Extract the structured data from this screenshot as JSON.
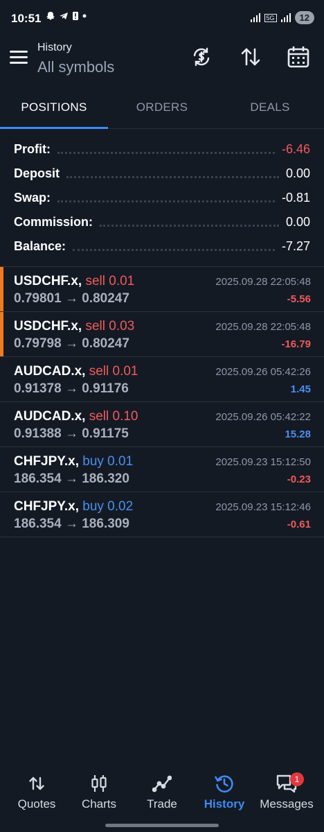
{
  "status_bar": {
    "time": "10:51",
    "battery": "12",
    "network": "5G"
  },
  "header": {
    "title": "History",
    "subtitle": "All symbols",
    "icons": [
      "menu-icon",
      "currency-swap-icon",
      "sort-icon",
      "calendar-icon"
    ]
  },
  "tabs": [
    {
      "label": "POSITIONS",
      "active": true
    },
    {
      "label": "ORDERS",
      "active": false
    },
    {
      "label": "DEALS",
      "active": false
    }
  ],
  "summary": [
    {
      "label": "Profit:",
      "value": "-6.46",
      "negative": true
    },
    {
      "label": "Deposit",
      "value": "0.00",
      "negative": false
    },
    {
      "label": "Swap:",
      "value": "-0.81",
      "negative": false
    },
    {
      "label": "Commission:",
      "value": "0.00",
      "negative": false
    },
    {
      "label": "Balance:",
      "value": "-7.27",
      "negative": false
    }
  ],
  "deals": [
    {
      "symbol": "USDCHF.x,",
      "side": "sell 0.01",
      "side_type": "sell",
      "prices": "0.79801 → 0.80247",
      "time": "2025.09.28 22:05:48",
      "profit": "-5.56",
      "profit_type": "neg",
      "marked": true
    },
    {
      "symbol": "USDCHF.x,",
      "side": "sell 0.03",
      "side_type": "sell",
      "prices": "0.79798 → 0.80247",
      "time": "2025.09.28 22:05:48",
      "profit": "-16.79",
      "profit_type": "neg",
      "marked": true
    },
    {
      "symbol": "AUDCAD.x,",
      "side": "sell 0.01",
      "side_type": "sell",
      "prices": "0.91378 → 0.91176",
      "time": "2025.09.26 05:42:26",
      "profit": "1.45",
      "profit_type": "pos",
      "marked": false
    },
    {
      "symbol": "AUDCAD.x,",
      "side": "sell 0.10",
      "side_type": "sell",
      "prices": "0.91388 → 0.91175",
      "time": "2025.09.26 05:42:22",
      "profit": "15.28",
      "profit_type": "pos",
      "marked": false
    },
    {
      "symbol": "CHFJPY.x,",
      "side": "buy 0.01",
      "side_type": "buy",
      "prices": "186.354 → 186.320",
      "time": "2025.09.23 15:12:50",
      "profit": "-0.23",
      "profit_type": "neg",
      "marked": false
    },
    {
      "symbol": "CHFJPY.x,",
      "side": "buy 0.02",
      "side_type": "buy",
      "prices": "186.354 → 186.309",
      "time": "2025.09.23 15:12:46",
      "profit": "-0.61",
      "profit_type": "neg",
      "marked": false
    }
  ],
  "bottom_nav": [
    {
      "label": "Quotes",
      "icon": "quotes-icon",
      "active": false
    },
    {
      "label": "Charts",
      "icon": "charts-icon",
      "active": false
    },
    {
      "label": "Trade",
      "icon": "trade-icon",
      "active": false
    },
    {
      "label": "History",
      "icon": "history-icon",
      "active": true
    },
    {
      "label": "Messages",
      "icon": "messages-icon",
      "active": false,
      "badge": "1"
    }
  ],
  "colors": {
    "background": "#141a24",
    "accent": "#3d8bf2",
    "negative": "#f05a5a",
    "positive": "#4a90f0",
    "marker": "#f07a1e"
  }
}
